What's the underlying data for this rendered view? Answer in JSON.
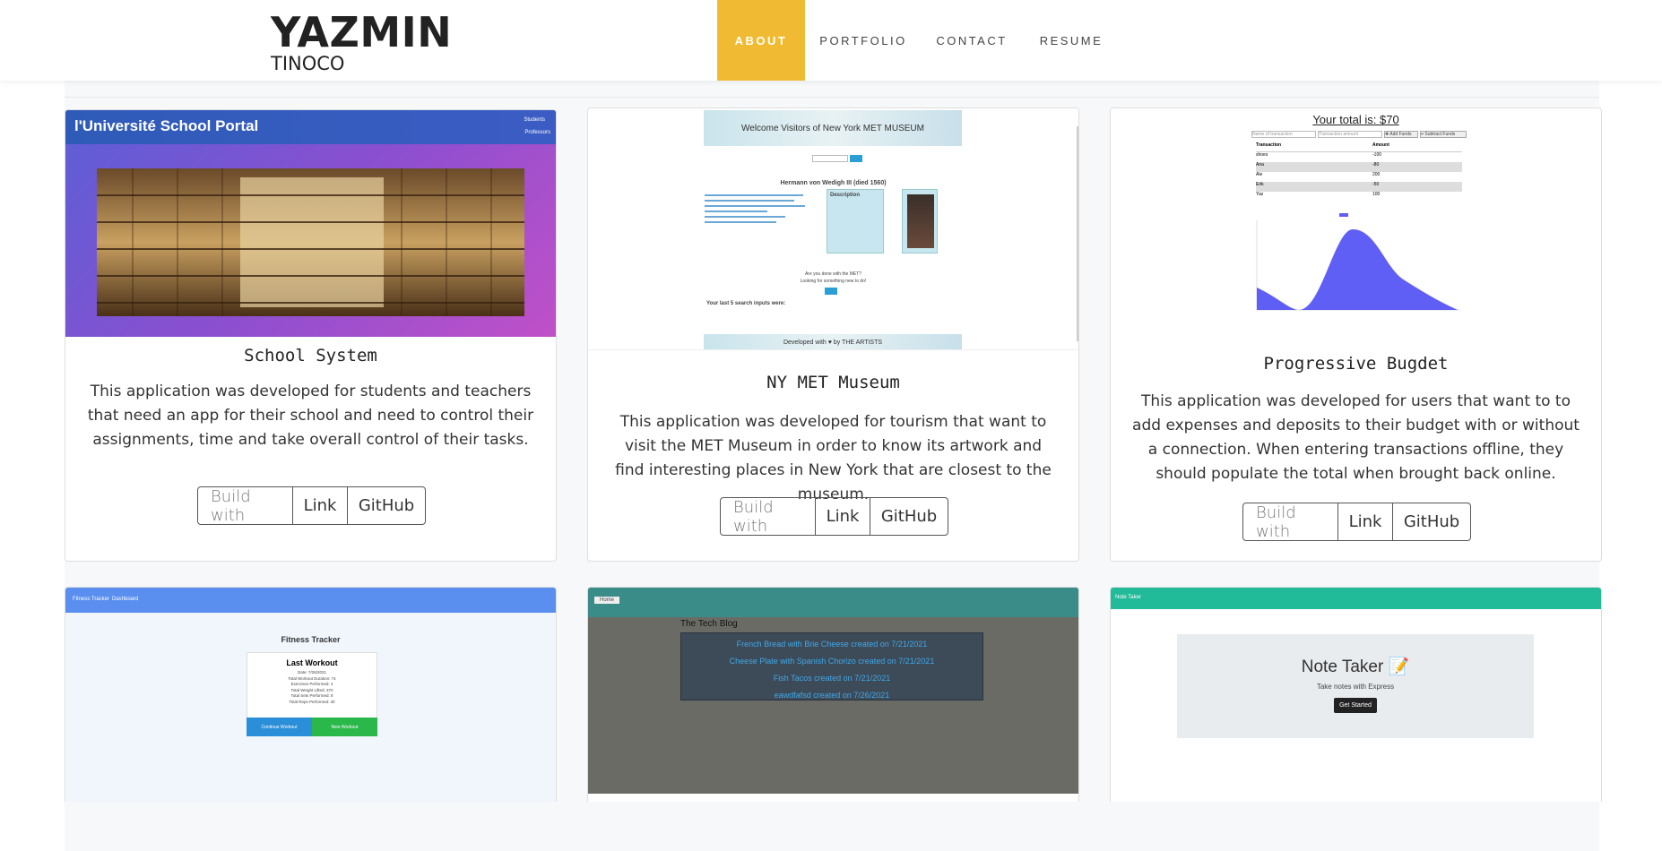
{
  "brand": {
    "first": "YAZMIN",
    "last": "TINOCO"
  },
  "nav": [
    {
      "label": "ABOUT",
      "active": true
    },
    {
      "label": "PORTFOLIO",
      "active": false
    },
    {
      "label": "CONTACT",
      "active": false
    },
    {
      "label": "RESUME",
      "active": false
    }
  ],
  "projects": [
    {
      "title": "School System",
      "description": "This application was developed for students and teachers that need an app for their school and need to control their assignments, time and take overall control of their tasks.",
      "buttons": [
        "Build with",
        "Link",
        "GitHub"
      ],
      "screenshot": {
        "header": "l'Université School Portal",
        "menu1": "Students",
        "menu2": "Professors"
      }
    },
    {
      "title": "NY MET Museum",
      "description": "This application was developed for tourism that want to visit the MET Museum in order to know its artwork and find interesting places in New York that are closest to the museum.",
      "buttons": [
        "Build with",
        "Link",
        "GitHub"
      ],
      "screenshot": {
        "banner": "Welcome Visitors of New York MET MUSEUM",
        "artwork_title": "Hermann von Wedigh III (died 1560)",
        "description_label": "Description",
        "done_text": "Are you done with the MET?",
        "looking_text": "Looking for something new to do!",
        "history_label": "Your last 5 search inputs were:",
        "footer": "Developed with ♥ by THE ARTISTS"
      }
    },
    {
      "title": "Progressive Bugdet",
      "description": "This application was developed for users that want to to add expenses and deposits to their budget with or without a connection. When entering transactions offline, they should populate the total when brought back online.",
      "buttons": [
        "Build with",
        "Link",
        "GitHub"
      ],
      "screenshot": {
        "total": "Your total is: $70",
        "input1": "Name of transaction",
        "input2": "Transaction amount",
        "add": "✚ Add Funds",
        "subtract": "━ Subtract Funds",
        "col1": "Transaction",
        "col2": "Amount",
        "rows": [
          [
            "shoes",
            "-100"
          ],
          [
            "Ana",
            "-80"
          ],
          [
            "Ale",
            "200"
          ],
          [
            "Erik",
            "-50"
          ],
          [
            "Yaz",
            "100"
          ]
        ]
      }
    },
    {
      "screenshot": {
        "nav1": "Fitness Tracker",
        "nav2": "Dashboard",
        "title": "Fitness Tracker",
        "card_title": "Last Workout",
        "lines": [
          "Date: 7/26/2021",
          "Total Workout Duration: 74",
          "Exercises Performed: 4",
          "Total Weight Lifted: 370",
          "Total Sets Performed: 8",
          "Total Reps Performed: 30"
        ],
        "btn_continue": "Continue Workout",
        "btn_new": "New Workout"
      }
    },
    {
      "screenshot": {
        "home": "Home",
        "title": "The Tech Blog",
        "posts": [
          "French Bread with Brie Cheese created on 7/21/2021",
          "Cheese Plate with Spanish Chorizo created on 7/21/2021",
          "Fish Tacos created on 7/21/2021",
          "eawdfafsd created on 7/26/2021"
        ]
      }
    },
    {
      "screenshot": {
        "nav": "Note Taker",
        "title": "Note Taker 📝",
        "subtitle": "Take notes with Express",
        "button": "Get Started"
      }
    }
  ],
  "colors": {
    "accent": "#f0bb32",
    "budget_chart": "#5f5ff5",
    "fitness_nav": "#5a8ff0",
    "note_nav": "#22bb99",
    "blog_bg": "#6b6b66"
  }
}
